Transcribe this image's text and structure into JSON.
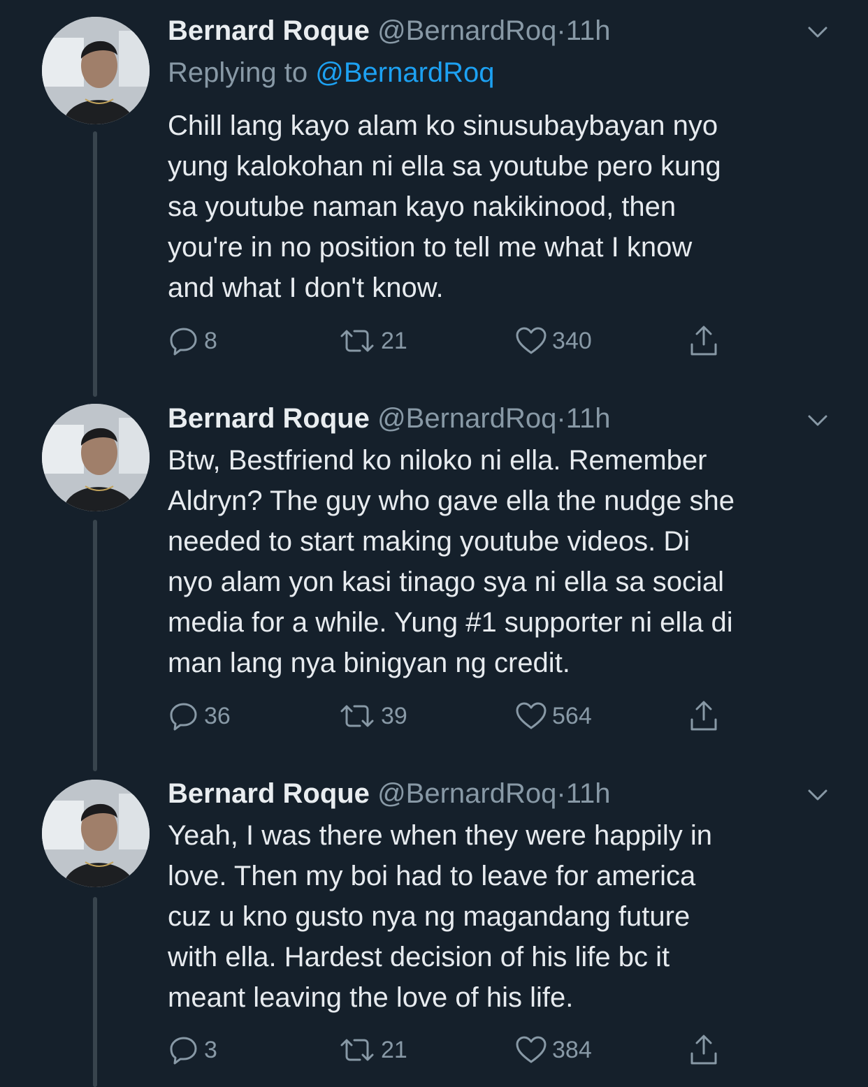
{
  "tweets": [
    {
      "name": "Bernard Roque",
      "handle": "@BernardRoq",
      "dot": "·",
      "time": "11h",
      "replying_prefix": "Replying to ",
      "replying_handle": "@BernardRoq",
      "lines": [
        "Chill lang kayo alam ko sinusubaybayan nyo",
        "yung kalokohan ni ella sa youtube pero kung",
        "sa youtube naman kayo nakikinood, then",
        "you're in no position to tell me what I know",
        "and what I don't know."
      ],
      "replies": "8",
      "retweets": "21",
      "likes": "340"
    },
    {
      "name": "Bernard Roque",
      "handle": "@BernardRoq",
      "dot": "·",
      "time": "11h",
      "lines": [
        "Btw, Bestfriend ko niloko ni ella. Remember",
        "Aldryn? The guy who gave ella the nudge she",
        "needed to start making youtube videos. Di",
        "nyo alam yon kasi tinago sya ni ella sa social",
        "media for a while. Yung #1 supporter ni ella di",
        "man lang nya binigyan ng credit."
      ],
      "replies": "36",
      "retweets": "39",
      "likes": "564"
    },
    {
      "name": "Bernard Roque",
      "handle": "@BernardRoq",
      "dot": "·",
      "time": "11h",
      "lines": [
        "Yeah, I was there when they were happily in",
        "love. Then my boi had to leave for america",
        "cuz u kno gusto nya ng magandang future",
        "with ella. Hardest decision of his life bc it",
        "meant leaving the love of his life."
      ],
      "replies": "3",
      "retweets": "21",
      "likes": "384"
    }
  ],
  "icons": {
    "reply": "reply-icon",
    "retweet": "retweet-icon",
    "like": "heart-icon",
    "share": "share-icon",
    "menu": "chevron-down-icon"
  },
  "colors": {
    "background": "#15202b",
    "text": "#e7ebef",
    "secondary": "#8899a6",
    "link": "#1da1f2",
    "thread_line": "#38444d"
  }
}
